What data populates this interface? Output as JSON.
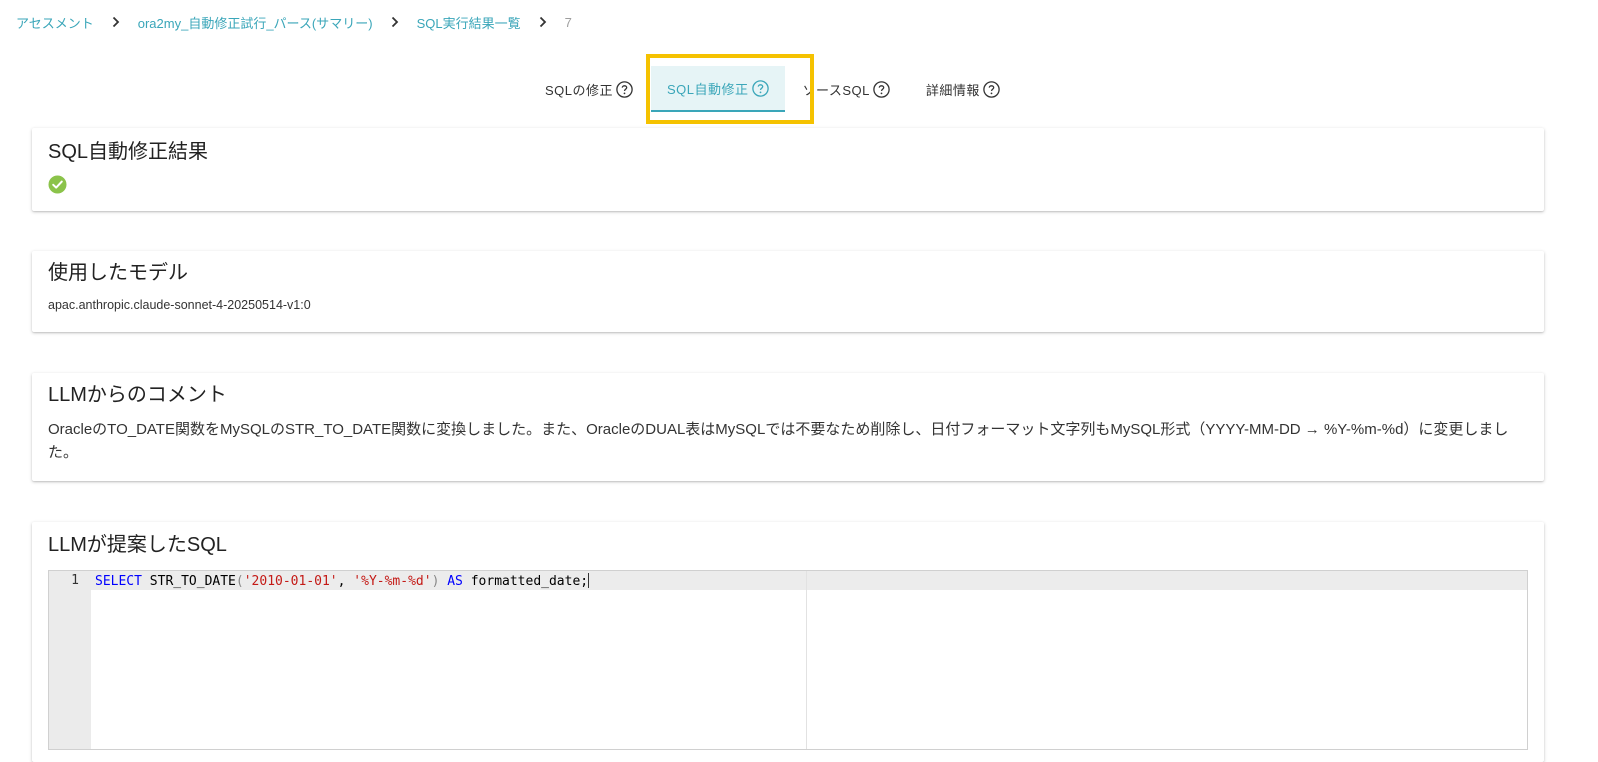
{
  "breadcrumb": {
    "items": [
      "アセスメント",
      "ora2my_自動修正試行_パース(サマリー)",
      "SQL実行結果一覧"
    ],
    "current": "7"
  },
  "tabs": [
    {
      "label": "SQLの修正",
      "active": false
    },
    {
      "label": "SQL自動修正",
      "active": true
    },
    {
      "label": "ソースSQL",
      "active": false
    },
    {
      "label": "詳細情報",
      "active": false
    }
  ],
  "result_card": {
    "title": "SQL自動修正結果",
    "status": "success"
  },
  "model_card": {
    "title": "使用したモデル",
    "model": "apac.anthropic.claude-sonnet-4-20250514-v1:0"
  },
  "comment_card": {
    "title": "LLMからのコメント",
    "text": "OracleのTO_DATE関数をMySQLのSTR_TO_DATE関数に変換しました。また、OracleのDUAL表はMySQLでは不要なため削除し、日付フォーマット文字列もMySQL形式（YYYY-MM-DD → %Y-%m-%d）に変更しました。"
  },
  "sql_card": {
    "title": "LLMが提案したSQL",
    "line_number": "1",
    "tokens": {
      "select": "SELECT",
      "func": " STR_TO_DATE",
      "open_paren": "(",
      "arg1": "'2010-01-01'",
      "comma": ", ",
      "arg2": "'%Y-%m-%d'",
      "close_paren": ")",
      "as": " AS",
      "alias": " formatted_date;"
    }
  },
  "colors": {
    "accent": "#3aa6b9",
    "highlight": "#f5c200",
    "success": "#8bc34a"
  }
}
